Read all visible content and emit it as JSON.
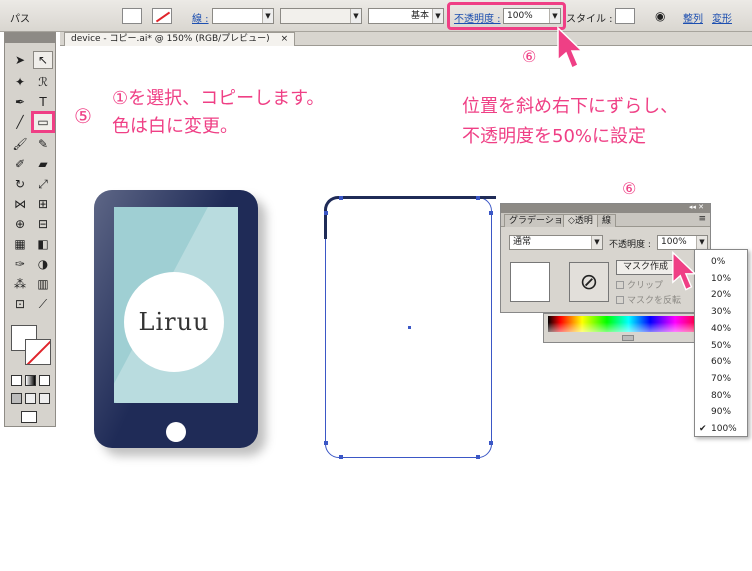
{
  "control_bar": {
    "path_label": "パス",
    "stroke_label": "線 :",
    "stroke_style": "基本",
    "opacity_label": "不透明度 :",
    "opacity_value": "100%",
    "style_label": "スタイル :",
    "align_link": "整列",
    "transform_link": "変形"
  },
  "document_tab": {
    "title": "device - コピー.ai* @ 150% (RGB/プレビュー)",
    "close": "×"
  },
  "annotations": {
    "step5": "⑤",
    "step1_line1": "①を選択、コピーします。",
    "step1_line2": "色は白に変更。",
    "step6_line1": "位置を斜め右下にずらし、",
    "step6_line2": "不透明度を50%に設定",
    "step6_marker_top": "⑥",
    "step6_marker_panel": "⑥"
  },
  "tablet_logo": "Liruu",
  "transparency_panel": {
    "tabs": [
      "グラデーション",
      "◇透明",
      "線"
    ],
    "active_tab": 1,
    "blend_mode": "通常",
    "opacity_label": "不透明度 :",
    "opacity_value": "100%",
    "mask_button": "マスク作成",
    "clip_label": "クリップ",
    "invert_mask_label": "マスクを反転"
  },
  "opacity_options": [
    "0%",
    "10%",
    "20%",
    "30%",
    "40%",
    "50%",
    "60%",
    "70%",
    "80%",
    "90%",
    "100%"
  ],
  "opacity_selected": "100%",
  "colors": {
    "annotation": "#ef3f85",
    "tablet_body": "#1f2b57",
    "tablet_screen": "#9fcfd3",
    "selection": "#3b57c6"
  }
}
